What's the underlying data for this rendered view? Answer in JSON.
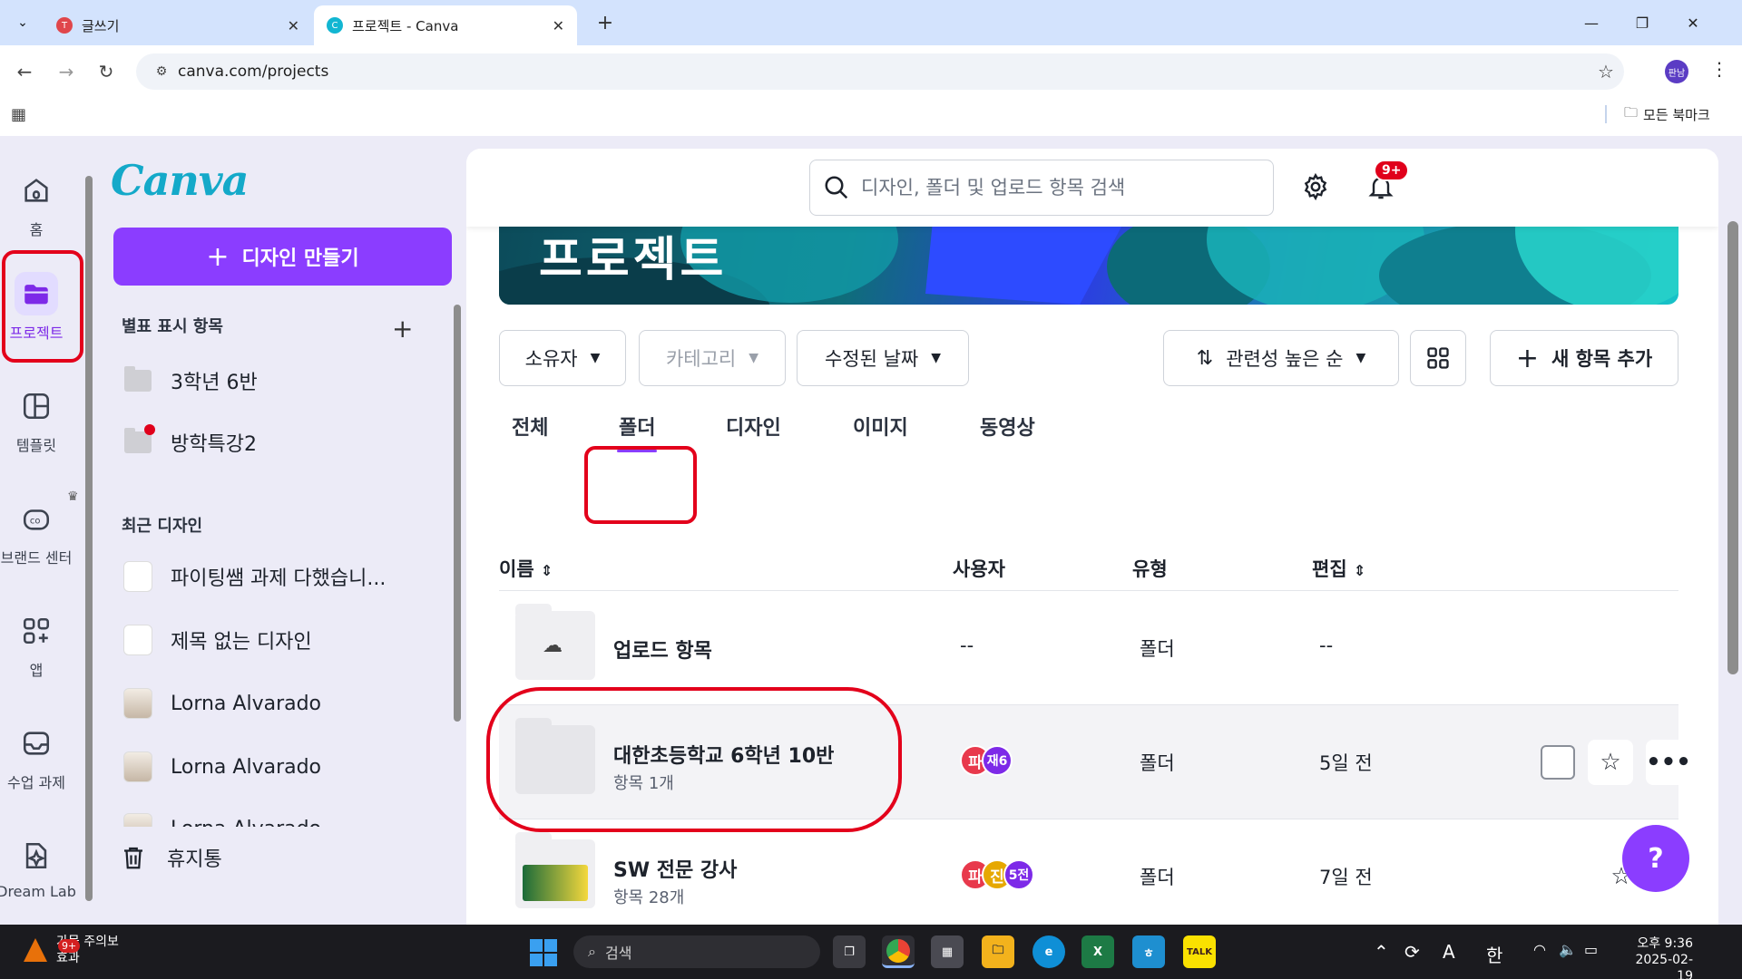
{
  "browser": {
    "tabs": [
      {
        "title": "글쓰기",
        "active": false
      },
      {
        "title": "프로젝트 - Canva",
        "active": true
      }
    ],
    "url": "canva.com/projects",
    "profile_initials": "판남",
    "all_bookmarks": "모든 북마크"
  },
  "rail": {
    "items": [
      {
        "label": "홈",
        "icon": "home-icon"
      },
      {
        "label": "프로젝트",
        "icon": "folder-open-icon",
        "active": true
      },
      {
        "label": "템플릿",
        "icon": "template-icon"
      },
      {
        "label": "브랜드 센터",
        "icon": "brand-kit-icon"
      },
      {
        "label": "앱",
        "icon": "apps-grid-icon"
      },
      {
        "label": "수업 과제",
        "icon": "inbox-tray-icon"
      },
      {
        "label": "Dream Lab",
        "icon": "sparkle-icon"
      }
    ]
  },
  "sidebar": {
    "logo": "Canva",
    "create_button": "디자인 만들기",
    "starred_heading": "별표 표시 항목",
    "starred": [
      {
        "label": "3학년 6반"
      },
      {
        "label": "방학특강2"
      }
    ],
    "recent_heading": "최근 디자인",
    "recent": [
      {
        "label": "파이팅쌤 과제 다했습니..."
      },
      {
        "label": "제목 없는 디자인"
      },
      {
        "label": "Lorna Alvarado"
      },
      {
        "label": "Lorna Alvarado"
      },
      {
        "label": "Lorna Alvarado"
      }
    ],
    "trash": "휴지통"
  },
  "header": {
    "search_placeholder": "디자인, 폴더 및 업로드 항목 검색",
    "notifications_badge": "9+"
  },
  "main": {
    "banner_title": "프로젝트",
    "filters": {
      "owner": "소유자",
      "category": "카테고리",
      "modified": "수정된 날짜",
      "sort": "관련성 높은 순",
      "add_new": "새 항목 추가"
    },
    "tabs": [
      {
        "label": "전체"
      },
      {
        "label": "폴더",
        "active": true
      },
      {
        "label": "디자인"
      },
      {
        "label": "이미지"
      },
      {
        "label": "동영상"
      }
    ],
    "columns": {
      "name": "이름",
      "user": "사용자",
      "type": "유형",
      "edited": "편집"
    },
    "rows": [
      {
        "name": "업로드 항목",
        "sub": "",
        "user": "--",
        "type": "폴더",
        "edited": "--"
      },
      {
        "name": "대한초등학교 6학년 10반",
        "sub": "항목 1개",
        "avatars": [
          "파",
          "재6"
        ],
        "type": "폴더",
        "edited": "5일 전"
      },
      {
        "name": "SW 전문 강사",
        "sub": "항목 28개",
        "avatars": [
          "파",
          "진",
          "5전"
        ],
        "type": "폴더",
        "edited": "7일 전"
      }
    ],
    "help": "?"
  },
  "taskbar": {
    "weather_badge": "9+",
    "weather_line1": "가뭄 주의보",
    "weather_line2": "효과",
    "search": "검색",
    "ime_a": "A",
    "ime_ko": "한",
    "time": "오후 9:36",
    "date": "2025-02-19"
  },
  "colors": {
    "accent": "#8b3dff",
    "annotation_red": "#e3001b",
    "canva_teal": "#14a9c9"
  }
}
